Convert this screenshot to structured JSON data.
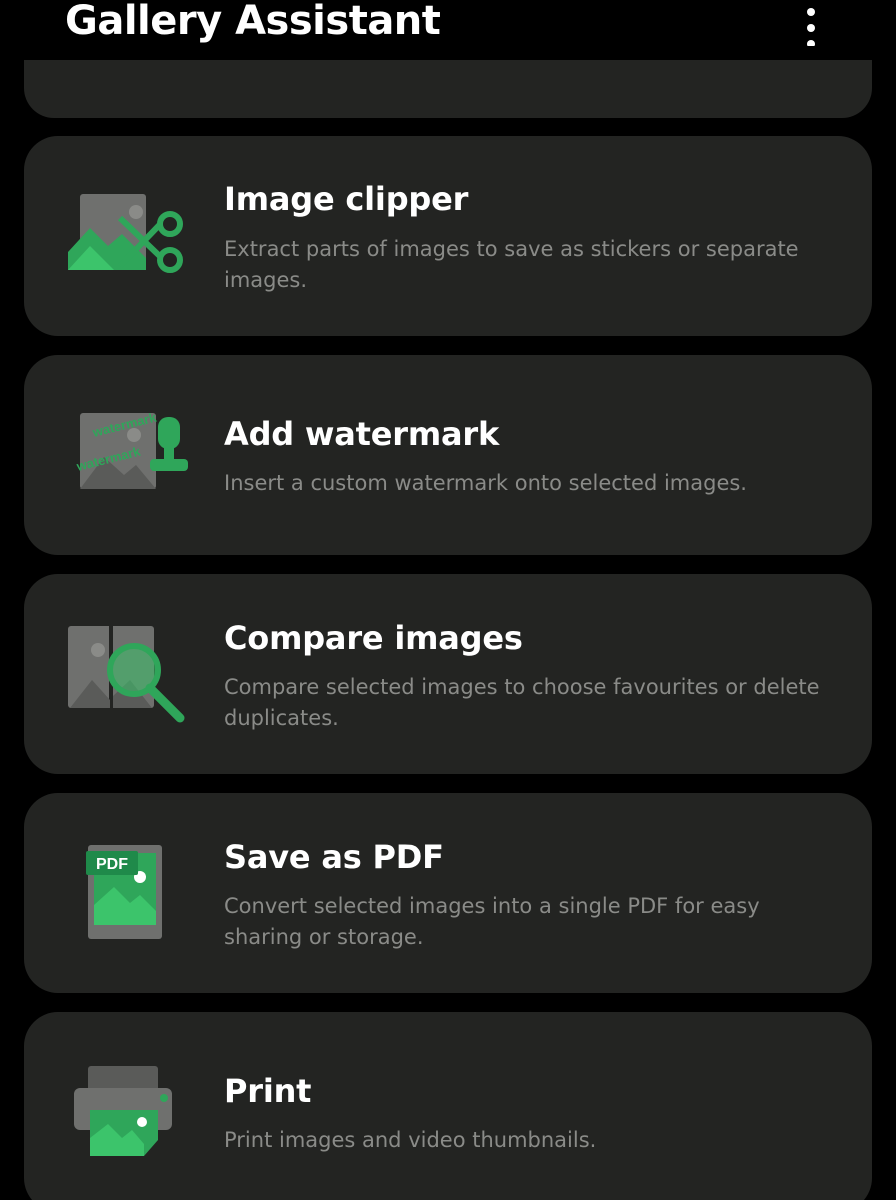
{
  "header": {
    "title": "Gallery Assistant",
    "more_icon": "more-vertical-icon"
  },
  "colors": {
    "background": "#000000",
    "card": "#232422",
    "accent": "#2fa65a",
    "title": "#ffffff",
    "description": "#8a8b88"
  },
  "items": [
    {
      "title": "Image clipper",
      "description": "Extract parts of images to save as stickers or separate images.",
      "icon": "image-clipper-icon"
    },
    {
      "title": "Add watermark",
      "description": "Insert a custom watermark onto selected images.",
      "icon": "watermark-stamp-icon",
      "icon_text": "watermark"
    },
    {
      "title": "Compare images",
      "description": "Compare selected images to choose favourites or delete duplicates.",
      "icon": "compare-images-icon"
    },
    {
      "title": "Save as PDF",
      "description": "Convert selected images into a single PDF for easy sharing or storage.",
      "icon": "pdf-document-icon",
      "icon_text": "PDF"
    },
    {
      "title": "Print",
      "description": "Print images and video thumbnails.",
      "icon": "printer-icon"
    }
  ]
}
